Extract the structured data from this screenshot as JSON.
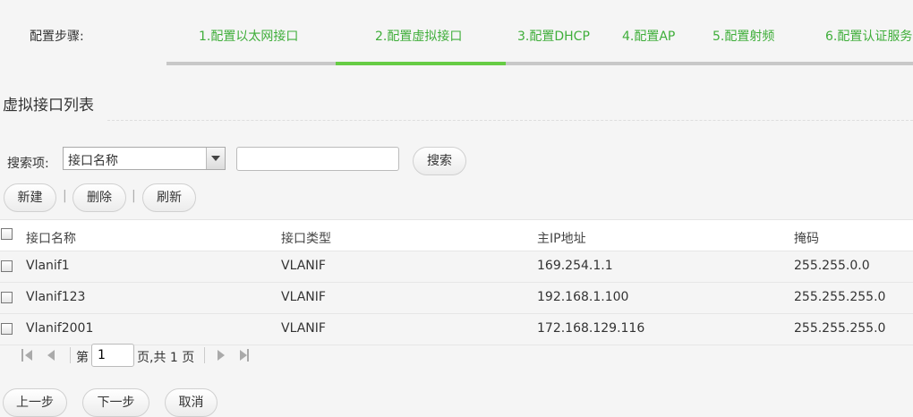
{
  "steps": {
    "label": "配置步骤:",
    "items": [
      {
        "label": "1.配置以太网接口"
      },
      {
        "label": "2.配置虚拟接口"
      },
      {
        "label": "3.配置DHCP"
      },
      {
        "label": "4.配置AP"
      },
      {
        "label": "5.配置射频"
      },
      {
        "label": "6.配置认证服务"
      }
    ],
    "active_index": 1
  },
  "section_title": "虚拟接口列表",
  "search": {
    "label": "搜索项:",
    "field_selected": "接口名称",
    "query_value": "",
    "button_label": "搜索"
  },
  "toolbar": {
    "new_label": "新建",
    "delete_label": "删除",
    "refresh_label": "刷新"
  },
  "table": {
    "columns": [
      "接口名称",
      "接口类型",
      "主IP地址",
      "掩码"
    ],
    "rows": [
      [
        "Vlanif1",
        "VLANIF",
        "169.254.1.1",
        "255.255.0.0"
      ],
      [
        "Vlanif123",
        "VLANIF",
        "192.168.1.100",
        "255.255.255.0"
      ],
      [
        "Vlanif2001",
        "VLANIF",
        "172.168.129.116",
        "255.255.255.0"
      ]
    ]
  },
  "pager": {
    "prefix": "第",
    "current_page": "1",
    "suffix": "页,共 1 页"
  },
  "footer": {
    "prev_label": "上一步",
    "next_label": "下一步",
    "cancel_label": "取消"
  },
  "colors": {
    "accent_green": "#3fae3a",
    "active_bar": "#66cc44",
    "track_gray": "#c8c8c8"
  }
}
